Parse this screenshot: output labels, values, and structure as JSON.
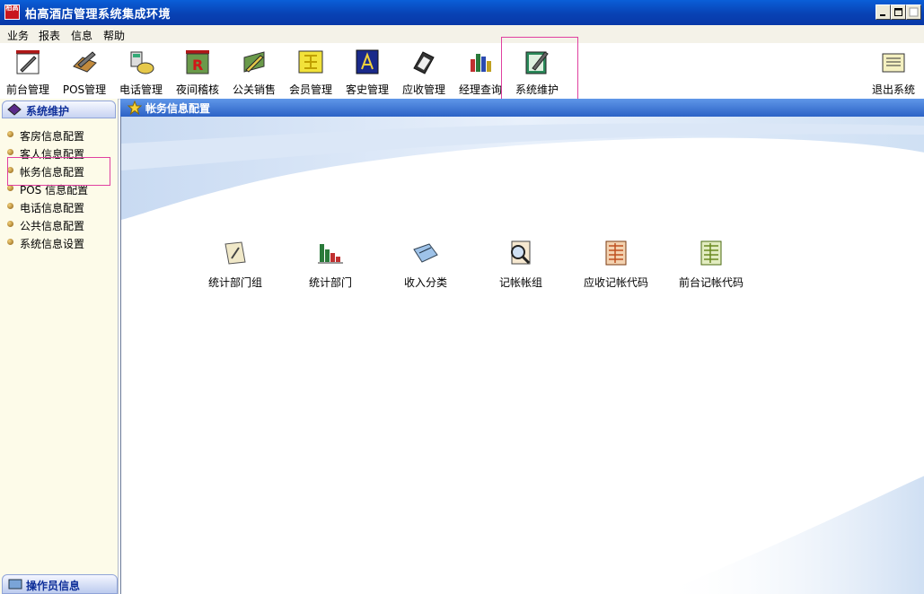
{
  "window": {
    "title": "柏高酒店管理系统集成环境",
    "logo_text": "柏高"
  },
  "menu": [
    "业务",
    "报表",
    "信息",
    "帮助"
  ],
  "toolbar": {
    "items": [
      {
        "label": "前台管理",
        "icon": "pen-doc-icon"
      },
      {
        "label": "POS管理",
        "icon": "pencil-book-icon"
      },
      {
        "label": "电话管理",
        "icon": "phone-icon"
      },
      {
        "label": "夜间稽核",
        "icon": "r-audit-icon"
      },
      {
        "label": "公关销售",
        "icon": "sales-icon"
      },
      {
        "label": "会员管理",
        "icon": "member-card-icon"
      },
      {
        "label": "客史管理",
        "icon": "guest-history-icon"
      },
      {
        "label": "应收管理",
        "icon": "receivable-icon"
      },
      {
        "label": "经理查询",
        "icon": "bar-chart-icon"
      },
      {
        "label": "系统维护",
        "icon": "system-maintain-icon"
      }
    ],
    "exit_label": "退出系统"
  },
  "sidebar": {
    "header": "系统维护",
    "items": [
      "客房信息配置",
      "客人信息配置",
      "帐务信息配置",
      "POS 信息配置",
      "电话信息配置",
      "公共信息配置",
      "系统信息设置"
    ],
    "footer": "操作员信息"
  },
  "content": {
    "header": "帐务信息配置",
    "icons": [
      {
        "label": "统计部门组",
        "icon": "notepad-icon"
      },
      {
        "label": "统计部门",
        "icon": "bar-chart-icon"
      },
      {
        "label": "收入分类",
        "icon": "category-icon"
      },
      {
        "label": "记帐帐组",
        "icon": "ledger-group-icon"
      },
      {
        "label": "应收记帐代码",
        "icon": "ledger-code-red-icon"
      },
      {
        "label": "前台记帐代码",
        "icon": "ledger-code-green-icon"
      }
    ]
  },
  "colors": {
    "titlebar": "#0842b4",
    "highlight_box": "#e040a0",
    "sidebar_bg": "#fdfbe9",
    "header_blue": "#2c62c6"
  }
}
